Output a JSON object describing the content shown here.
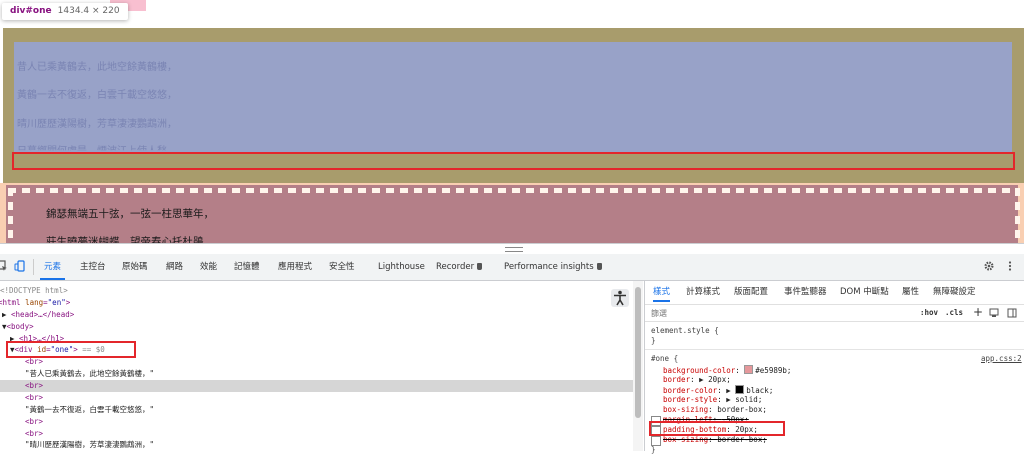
{
  "tooltip": {
    "selector": "div#one",
    "dimensions": "1434.4 × 220"
  },
  "poem1": [
    "昔人已乘黃鶴去，此地空餘黃鶴樓，",
    "黃鶴一去不復返，白雲千載空悠悠，",
    "晴川歷歷漢陽樹，芳草淒淒鸚鵡洲，",
    "日暮鄉關何處是，煙波江上使人愁，"
  ],
  "poem2": [
    "錦瑟無端五十弦，一弦一柱思華年，",
    "莊生曉夢迷蝴蝶，望帝春心托杜鵑，"
  ],
  "devtools": {
    "tabs": [
      "元素",
      "主控台",
      "原始碼",
      "網路",
      "效能",
      "記憶體",
      "應用程式",
      "安全性",
      "Lighthouse",
      "Recorder",
      "Performance insights"
    ],
    "active_tab": "元素",
    "dom": {
      "doctype": "<!DOCTYPE html>",
      "html_tag": "html",
      "html_attr": "lang",
      "html_val": "\"en\"",
      "head_collapsed": "<head>…</head>",
      "body_tag": "<body>",
      "h1_collapsed": "<h1>…</h1>",
      "div_tag": "div",
      "div_attr": "id",
      "div_val": "\"one\"",
      "dollar0": "== $0",
      "br": "<br>",
      "line1": "\"昔人已乘黃鶴去，此地空餘黃鶴樓，\"",
      "line2": "\"黃鶴一去不復返，白雲千載空悠悠，\"",
      "line3": "\"晴川歷歷漢陽樹，芳草淒淒鸚鵡洲，\""
    },
    "styles_tabs": [
      "樣式",
      "計算樣式",
      "版面配置",
      "事件監聽器",
      "DOM 中斷點",
      "屬性",
      "無障礙設定"
    ],
    "filter_placeholder": "篩選",
    "hov": ":hov",
    "cls": ".cls",
    "element_style": "element.style {",
    "close_brace": "}",
    "rule_selector": "#one {",
    "rule_source": "app.css:2",
    "props": [
      {
        "name": "background-color",
        "value": "#e5989b",
        "swatch": "#e5989b"
      },
      {
        "name": "border",
        "value": "20px",
        "arrow": true
      },
      {
        "name": "border-color",
        "value": "black",
        "arrow": true,
        "swatch": "#000000"
      },
      {
        "name": "border-style",
        "value": "solid",
        "arrow": true
      },
      {
        "name": "box-sizing",
        "value": "border-box"
      },
      {
        "name": "margin-left",
        "value": "-50px",
        "struck": true
      },
      {
        "name": "padding-bottom",
        "value": "20px"
      },
      {
        "name": "box-sizing",
        "value": "border-box",
        "struck": true
      }
    ]
  }
}
